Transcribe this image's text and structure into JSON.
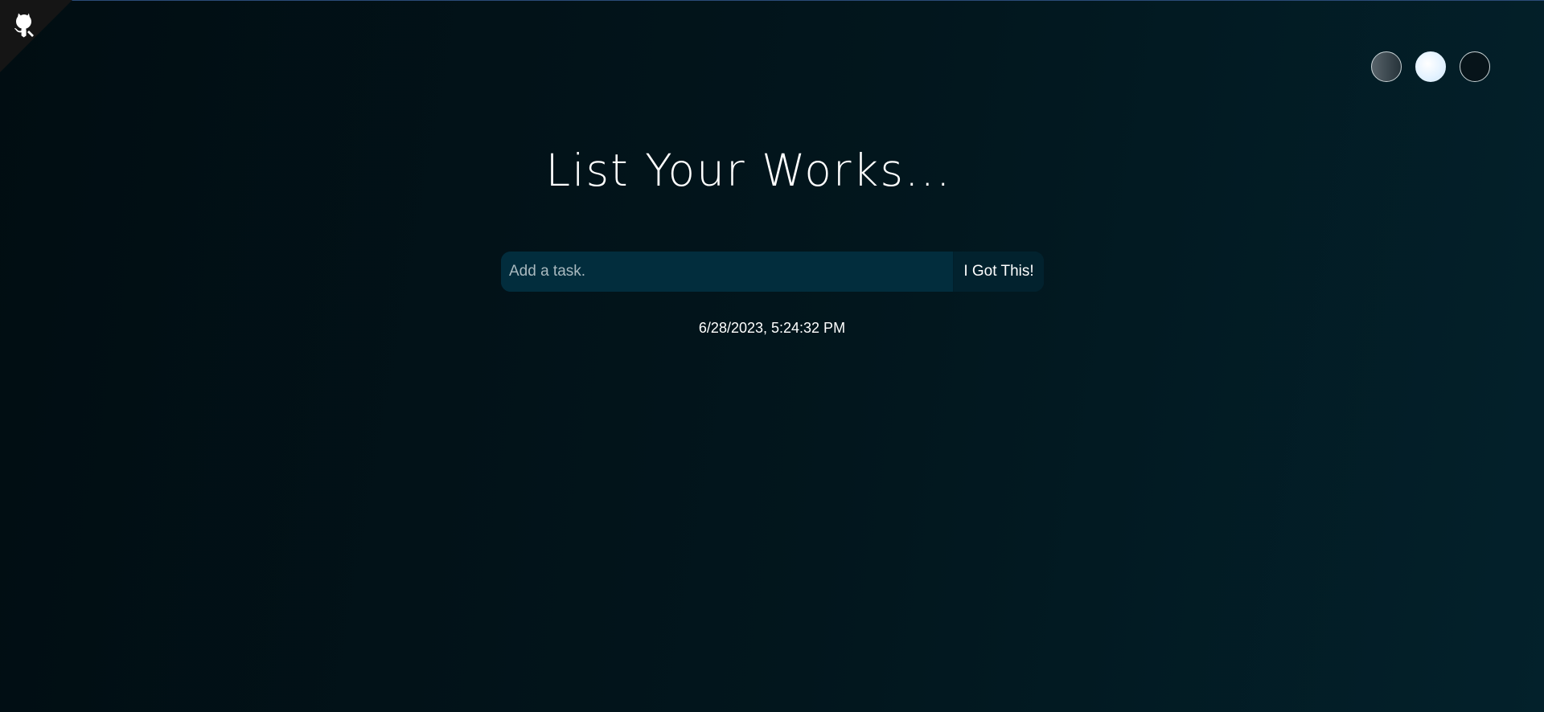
{
  "header": {
    "title": "List Your Works..."
  },
  "corner_link": {
    "icon": "github-octocat-icon"
  },
  "theme_switcher": {
    "options": [
      {
        "name": "standard-theme",
        "color": "#3a464d"
      },
      {
        "name": "light-theme",
        "color": "#e3f2ff"
      },
      {
        "name": "darker-theme",
        "color": "#07141a"
      }
    ]
  },
  "task_form": {
    "placeholder": "Add a task.",
    "value": "",
    "submit_label": "I Got This!"
  },
  "datetime": "6/28/2023, 5:24:32 PM",
  "colors": {
    "background_start": "#010d12",
    "background_end": "#03212b",
    "input_background": "#022d3d",
    "text": "#ffffff"
  }
}
